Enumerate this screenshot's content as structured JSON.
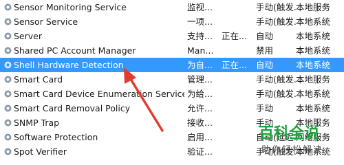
{
  "colors": {
    "selected_bg": "#3399ff",
    "selected_text": "#ffffff",
    "arrow": "#e03c31",
    "watermark": "#1aa33a"
  },
  "icon_name": "gear-service-icon",
  "services": [
    {
      "name": "Sensor Monitoring Service",
      "description": "监视...",
      "status": "",
      "startup": "手动(触发...",
      "logon": "本地服务"
    },
    {
      "name": "Sensor Service",
      "description": "一项...",
      "status": "",
      "startup": "手动(触发...",
      "logon": "本地系统"
    },
    {
      "name": "Server",
      "description": "支持...",
      "status": "正在...",
      "startup": "自动",
      "logon": "本地系统"
    },
    {
      "name": "Shared PC Account Manager",
      "description": "Man...",
      "status": "",
      "startup": "禁用",
      "logon": "本地系统"
    },
    {
      "name": "Shell Hardware Detection",
      "description": "为自...",
      "status": "正在...",
      "startup": "自动",
      "logon": "本地系统",
      "selected": true
    },
    {
      "name": "Smart Card",
      "description": "管理...",
      "status": "",
      "startup": "手动(触发...",
      "logon": "本地服务"
    },
    {
      "name": "Smart Card Device Enumeration Service",
      "description": "为给...",
      "status": "",
      "startup": "手动(触发...",
      "logon": "本地系统"
    },
    {
      "name": "Smart Card Removal Policy",
      "description": "允许...",
      "status": "",
      "startup": "手动",
      "logon": "本地系统"
    },
    {
      "name": "SNMP Trap",
      "description": "接收...",
      "status": "",
      "startup": "手动",
      "logon": "本地服务"
    },
    {
      "name": "Software Protection",
      "description": "启用...",
      "status": "",
      "startup": "自动(延迟...",
      "logon": "网络服务"
    },
    {
      "name": "Spot Verifier",
      "description": "验证...",
      "status": "",
      "startup": "手动(触发...",
      "logon": "本地系统"
    }
  ],
  "watermark": {
    "logo_text": "百科全说",
    "subtitle": "助你轻松解决"
  }
}
